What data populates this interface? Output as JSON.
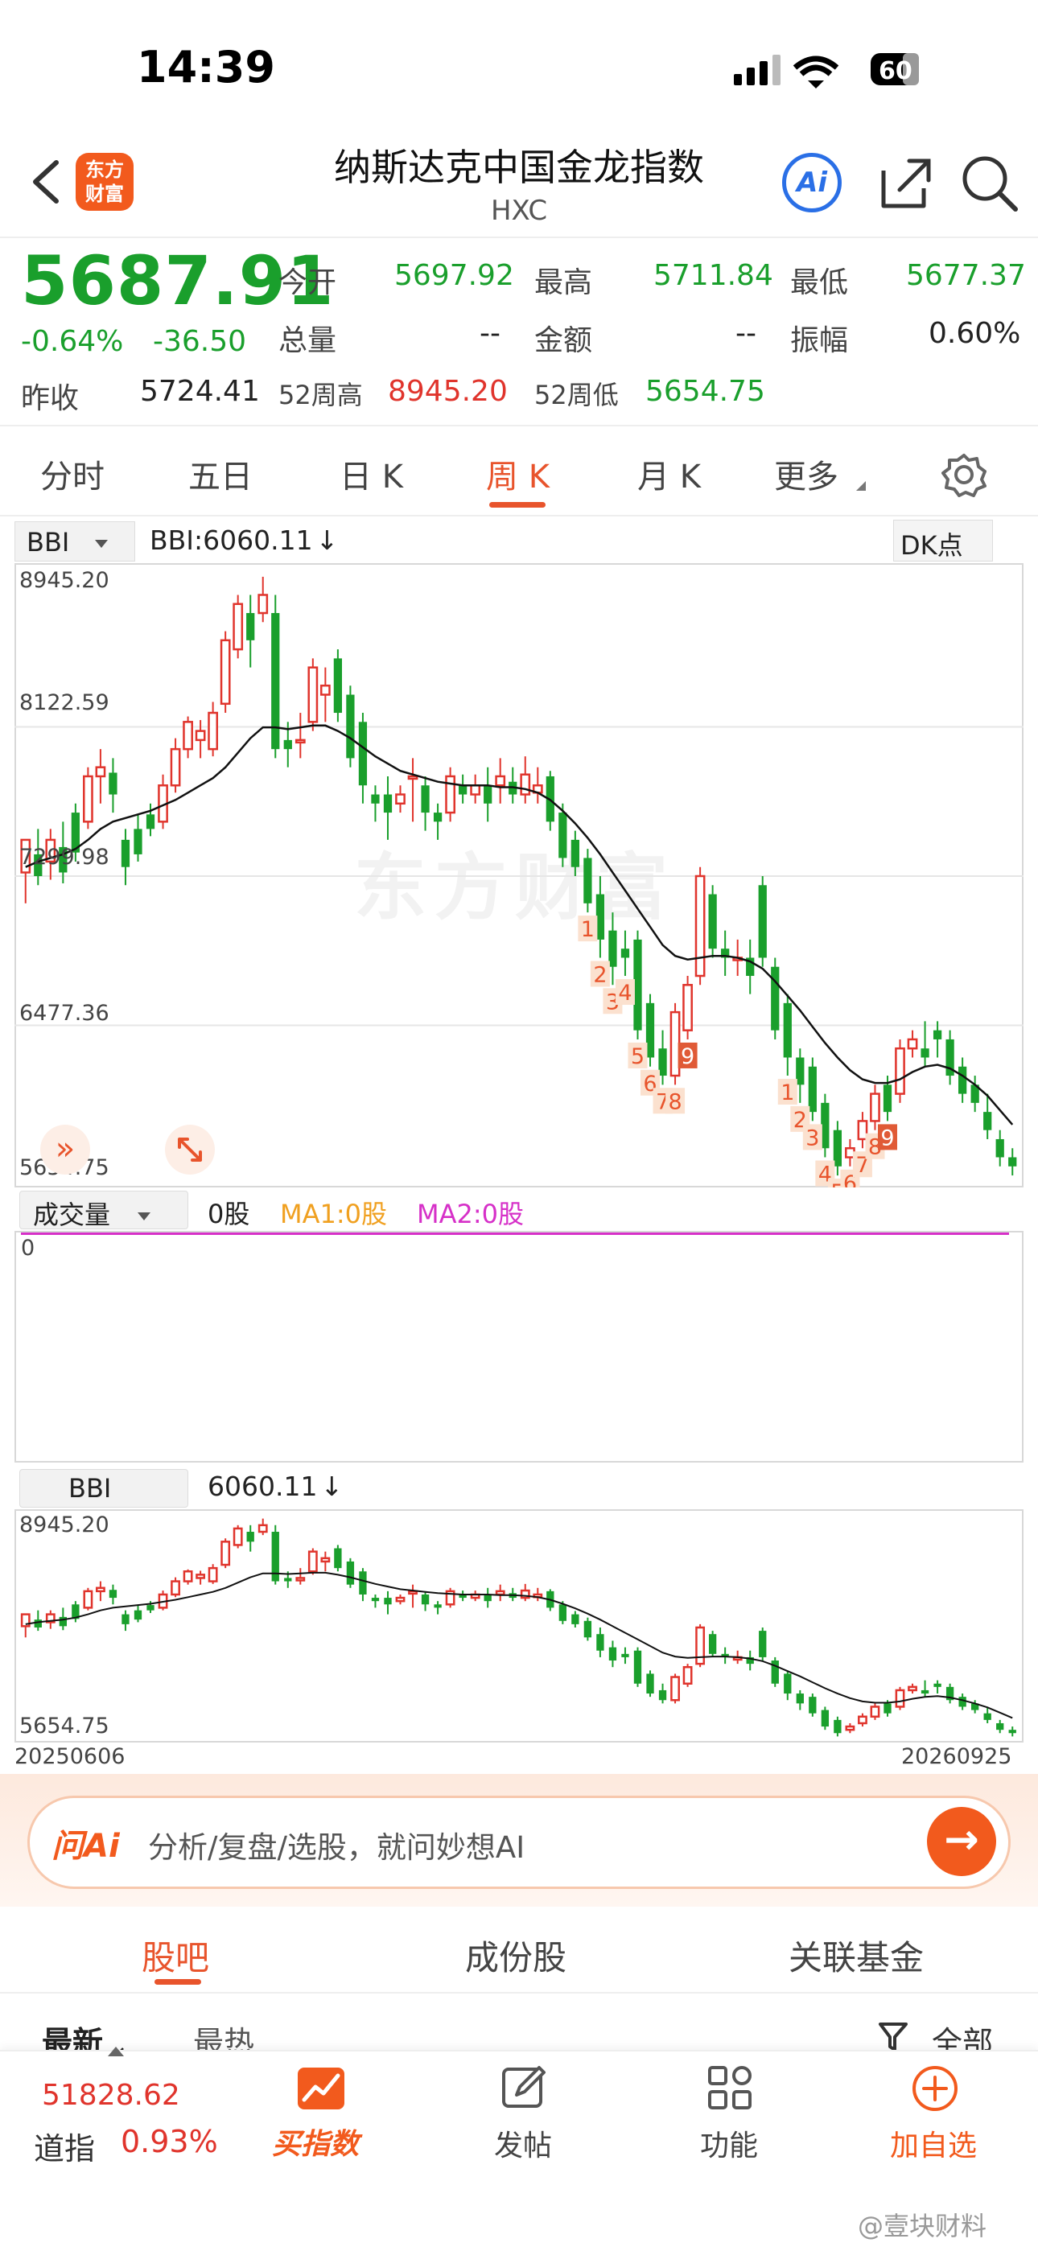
{
  "status": {
    "time": "14:39",
    "battery": "60"
  },
  "header": {
    "logo_text": "东方\n财富",
    "title": "纳斯达克中国金龙指数",
    "subtitle": "HXC",
    "ai_label": "Ai"
  },
  "quote": {
    "price": "5687.91",
    "change_pct": "-0.64%",
    "change": "-36.50",
    "prev_close_label": "昨收",
    "prev_close": "5724.41",
    "open_label": "今开",
    "open": "5697.92",
    "high_label": "最高",
    "high": "5711.84",
    "low_label": "最低",
    "low": "5677.37",
    "volume_label": "总量",
    "volume": "--",
    "amount_label": "金额",
    "amount": "--",
    "amplitude_label": "振幅",
    "amplitude": "0.60%",
    "w52_high_label": "52周高",
    "w52_high": "8945.20",
    "w52_low_label": "52周低",
    "w52_low": "5654.75"
  },
  "tabs": [
    "分时",
    "五日",
    "日 K",
    "周 K",
    "月 K",
    "更多"
  ],
  "active_tab": "周 K",
  "main_chart": {
    "indicator": "BBI",
    "indicator_value": "BBI:6060.11",
    "dk_button": "DK点",
    "axis_labels": [
      "8945.20",
      "8122.59",
      "7299.98",
      "6477.36",
      "5654.75"
    ],
    "watermark": "东方财富"
  },
  "volume_panel": {
    "selector": "成交量",
    "vol": "0股",
    "ma1": "MA1:0股",
    "ma2": "MA2:0股",
    "zero": "0",
    "ma1_color": "#f0a020",
    "ma2_color": "#d630c8"
  },
  "bbi_panel": {
    "selector": "BBI",
    "value": "6060.11",
    "top_label": "8945.20",
    "bottom_label": "5654.75",
    "start_date": "20250606",
    "end_date": "20260925"
  },
  "chart_data": {
    "type": "candlestick",
    "ylim": [
      5654.75,
      8945.2
    ],
    "up_color": "#e0342c",
    "down_color": "#1a9f2c",
    "candles": [
      [
        7320,
        7500,
        7150,
        7400
      ],
      [
        7420,
        7300,
        7250,
        7560
      ],
      [
        7380,
        7500,
        7280,
        7560
      ],
      [
        7460,
        7320,
        7260,
        7600
      ],
      [
        7650,
        7430,
        7380,
        7700
      ],
      [
        7600,
        7850,
        7560,
        7900
      ],
      [
        7850,
        7900,
        7700,
        8000
      ],
      [
        7870,
        7750,
        7650,
        7950
      ],
      [
        7500,
        7350,
        7250,
        7560
      ],
      [
        7560,
        7420,
        7380,
        7640
      ],
      [
        7640,
        7560,
        7520,
        7700
      ],
      [
        7600,
        7800,
        7560,
        7860
      ],
      [
        7800,
        8000,
        7760,
        8060
      ],
      [
        8000,
        8150,
        7950,
        8180
      ],
      [
        8050,
        8100,
        7950,
        8160
      ],
      [
        8000,
        8200,
        7960,
        8260
      ],
      [
        8250,
        8600,
        8200,
        8650
      ],
      [
        8550,
        8800,
        8500,
        8850
      ],
      [
        8750,
        8600,
        8450,
        8850
      ],
      [
        8750,
        8850,
        8700,
        8950
      ],
      [
        8750,
        8000,
        7950,
        8850
      ],
      [
        8050,
        8000,
        7900,
        8150
      ],
      [
        8050,
        8050,
        7950,
        8200
      ],
      [
        8150,
        8450,
        8100,
        8500
      ],
      [
        8300,
        8350,
        8150,
        8450
      ],
      [
        8500,
        8200,
        8150,
        8550
      ],
      [
        8300,
        7950,
        7900,
        8350
      ],
      [
        8150,
        7800,
        7700,
        8200
      ],
      [
        7750,
        7700,
        7600,
        7800
      ],
      [
        7750,
        7650,
        7500,
        7850
      ],
      [
        7700,
        7750,
        7650,
        7800
      ],
      [
        7850,
        7850,
        7600,
        7950
      ],
      [
        7800,
        7650,
        7550,
        7850
      ],
      [
        7650,
        7600,
        7500,
        7700
      ],
      [
        7650,
        7850,
        7600,
        7900
      ],
      [
        7800,
        7750,
        7700,
        7860
      ],
      [
        7750,
        7800,
        7700,
        7860
      ],
      [
        7800,
        7700,
        7600,
        7900
      ],
      [
        7800,
        7850,
        7700,
        7950
      ],
      [
        7820,
        7750,
        7700,
        7900
      ],
      [
        7750,
        7860,
        7700,
        7960
      ],
      [
        7760,
        7800,
        7700,
        7900
      ],
      [
        7850,
        7600,
        7550,
        7880
      ],
      [
        7650,
        7400,
        7350,
        7700
      ],
      [
        7500,
        7350,
        7300,
        7550
      ],
      [
        7400,
        7150,
        7100,
        7450
      ],
      [
        7200,
        6950,
        6850,
        7300
      ],
      [
        7000,
        6800,
        6700,
        7100
      ],
      [
        6900,
        6850,
        6750,
        7000
      ],
      [
        6950,
        6450,
        6400,
        7000
      ],
      [
        6600,
        6300,
        6250,
        6650
      ],
      [
        6350,
        6200,
        6150,
        6450
      ],
      [
        6200,
        6550,
        6150,
        6600
      ],
      [
        6450,
        6700,
        6400,
        6750
      ],
      [
        6750,
        7300,
        6700,
        7350
      ],
      [
        7200,
        6900,
        6850,
        7250
      ],
      [
        6900,
        6850,
        6750,
        7000
      ],
      [
        6850,
        6850,
        6750,
        6950
      ],
      [
        6850,
        6750,
        6650,
        6950
      ],
      [
        7250,
        6850,
        6800,
        7300
      ],
      [
        6800,
        6450,
        6400,
        6850
      ],
      [
        6600,
        6300,
        6200,
        6650
      ],
      [
        6300,
        6150,
        6050,
        6350
      ],
      [
        6250,
        6000,
        5950,
        6300
      ],
      [
        6050,
        5800,
        5750,
        6100
      ],
      [
        5900,
        5700,
        5650,
        5950
      ],
      [
        5750,
        5800,
        5700,
        5850
      ],
      [
        5850,
        5950,
        5800,
        6000
      ],
      [
        5950,
        6100,
        5900,
        6150
      ],
      [
        6150,
        6000,
        5950,
        6200
      ],
      [
        6100,
        6350,
        6050,
        6400
      ],
      [
        6350,
        6400,
        6300,
        6450
      ],
      [
        6350,
        6300,
        6250,
        6500
      ],
      [
        6450,
        6400,
        6300,
        6500
      ],
      [
        6400,
        6200,
        6150,
        6450
      ],
      [
        6250,
        6100,
        6050,
        6300
      ],
      [
        6150,
        6050,
        6000,
        6200
      ],
      [
        6000,
        5900,
        5850,
        6100
      ],
      [
        5850,
        5750,
        5700,
        5900
      ],
      [
        5750,
        5700,
        5650,
        5800
      ]
    ],
    "bbi": [
      7350,
      7380,
      7400,
      7420,
      7450,
      7500,
      7560,
      7600,
      7620,
      7640,
      7660,
      7690,
      7720,
      7760,
      7800,
      7840,
      7900,
      7980,
      8060,
      8120,
      8120,
      8110,
      8120,
      8130,
      8130,
      8100,
      8060,
      8010,
      7960,
      7920,
      7880,
      7860,
      7840,
      7820,
      7810,
      7800,
      7800,
      7800,
      7790,
      7790,
      7780,
      7760,
      7720,
      7660,
      7590,
      7510,
      7420,
      7320,
      7220,
      7120,
      7020,
      6920,
      6860,
      6840,
      6850,
      6860,
      6860,
      6850,
      6830,
      6790,
      6720,
      6640,
      6560,
      6470,
      6380,
      6300,
      6230,
      6180,
      6160,
      6160,
      6180,
      6220,
      6250,
      6260,
      6240,
      6200,
      6150,
      6090,
      6010,
      5930
    ],
    "seq_labels": [
      {
        "i": 45,
        "t": "1"
      },
      {
        "i": 46,
        "t": "2"
      },
      {
        "i": 47,
        "t": "3"
      },
      {
        "i": 48,
        "t": "4"
      },
      {
        "i": 49,
        "t": "5"
      },
      {
        "i": 50,
        "t": "6"
      },
      {
        "i": 51,
        "t": "7"
      },
      {
        "i": 52,
        "t": "8"
      },
      {
        "i": 53,
        "t": "9",
        "hl": true
      },
      {
        "i": 61,
        "t": "1"
      },
      {
        "i": 62,
        "t": "2"
      },
      {
        "i": 63,
        "t": "3"
      },
      {
        "i": 64,
        "t": "4"
      },
      {
        "i": 65,
        "t": "5"
      },
      {
        "i": 66,
        "t": "6"
      },
      {
        "i": 67,
        "t": "7"
      },
      {
        "i": 68,
        "t": "8"
      },
      {
        "i": 69,
        "t": "9",
        "hl": true
      }
    ]
  },
  "ask": {
    "label": "问Ai",
    "placeholder": "分析/复盘/选股，就问妙想AI"
  },
  "sub_tabs": [
    "股吧",
    "成份股",
    "关联基金"
  ],
  "filter": {
    "latest": "最新",
    "hot": "最热",
    "all": "全部"
  },
  "bottom_nav": {
    "ticker_value": "51828.62",
    "ticker_name": "道指",
    "ticker_pct": "0.93%",
    "buy": "买指数",
    "post": "发帖",
    "func": "功能",
    "add": "加自选"
  },
  "watermark": "@壹块财料"
}
